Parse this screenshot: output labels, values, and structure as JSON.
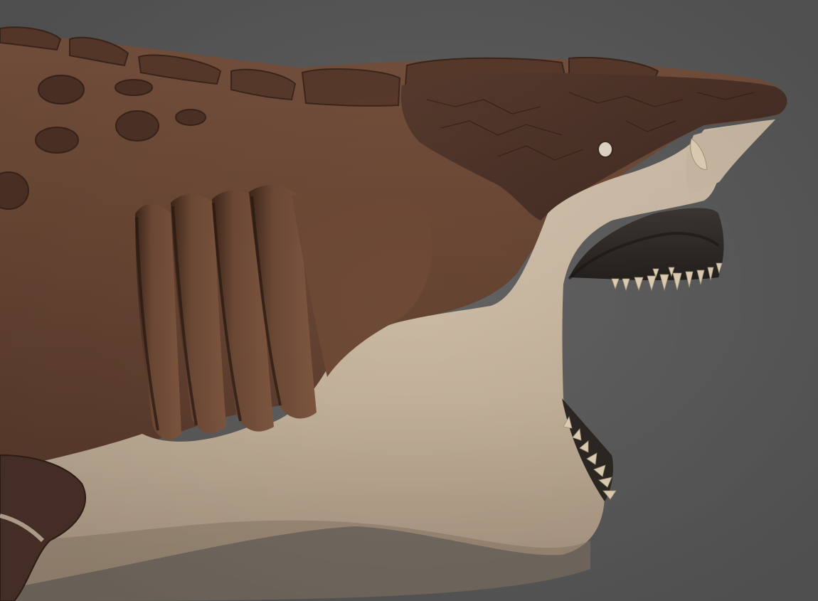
{
  "scene": {
    "subject": "armored-shark-head-render",
    "colors": {
      "background": "#5c5c5c",
      "dorsal_skin": "#6e4a36",
      "dorsal_skin_dark": "#4e3226",
      "head_plate": "#4a3128",
      "ventral_skin": "#cdbba5",
      "ventral_shadow": "#9c8b78",
      "mouth_interior": "#2e2a27",
      "teeth": "#e3d4ba",
      "eye": "#e8dccb"
    }
  }
}
